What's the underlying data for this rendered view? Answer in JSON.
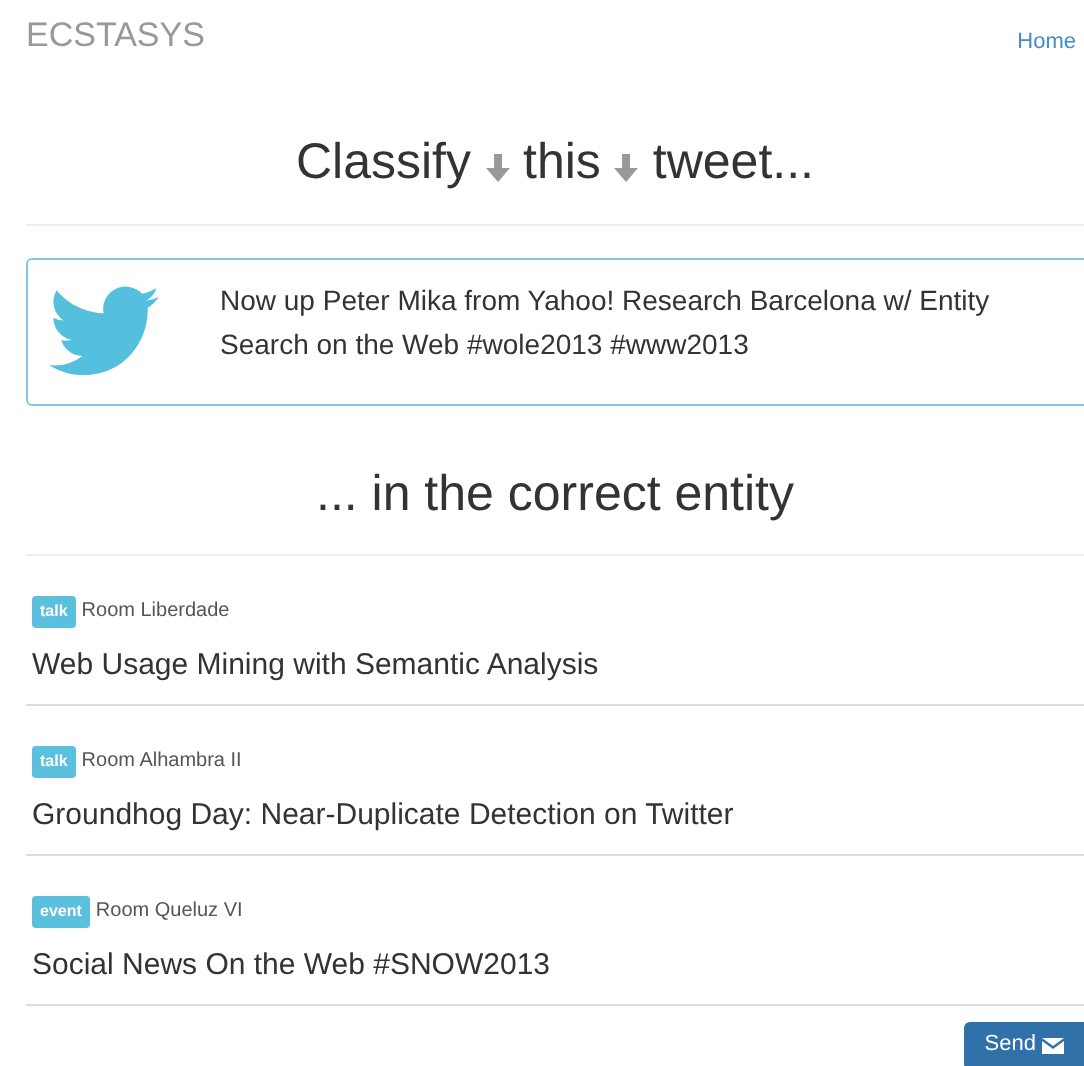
{
  "brand": "ECSTASYS",
  "nav": {
    "home": "Home"
  },
  "heading": {
    "words": [
      "Classify",
      "this",
      "tweet..."
    ]
  },
  "tweet": {
    "text": "Now up Peter Mika from Yahoo! Research Barcelona w/ Entity Search on the Web #wole2013 #www2013"
  },
  "subheading": "... in the correct entity",
  "entities": [
    {
      "badge": "talk",
      "room": "Room Liberdade",
      "title": "Web Usage Mining with Semantic Analysis"
    },
    {
      "badge": "talk",
      "room": "Room Alhambra II",
      "title": "Groundhog Day: Near-Duplicate Detection on Twitter"
    },
    {
      "badge": "event",
      "room": "Room Queluz VI",
      "title": "Social News On the Web #SNOW2013"
    }
  ],
  "send_button": "Send"
}
